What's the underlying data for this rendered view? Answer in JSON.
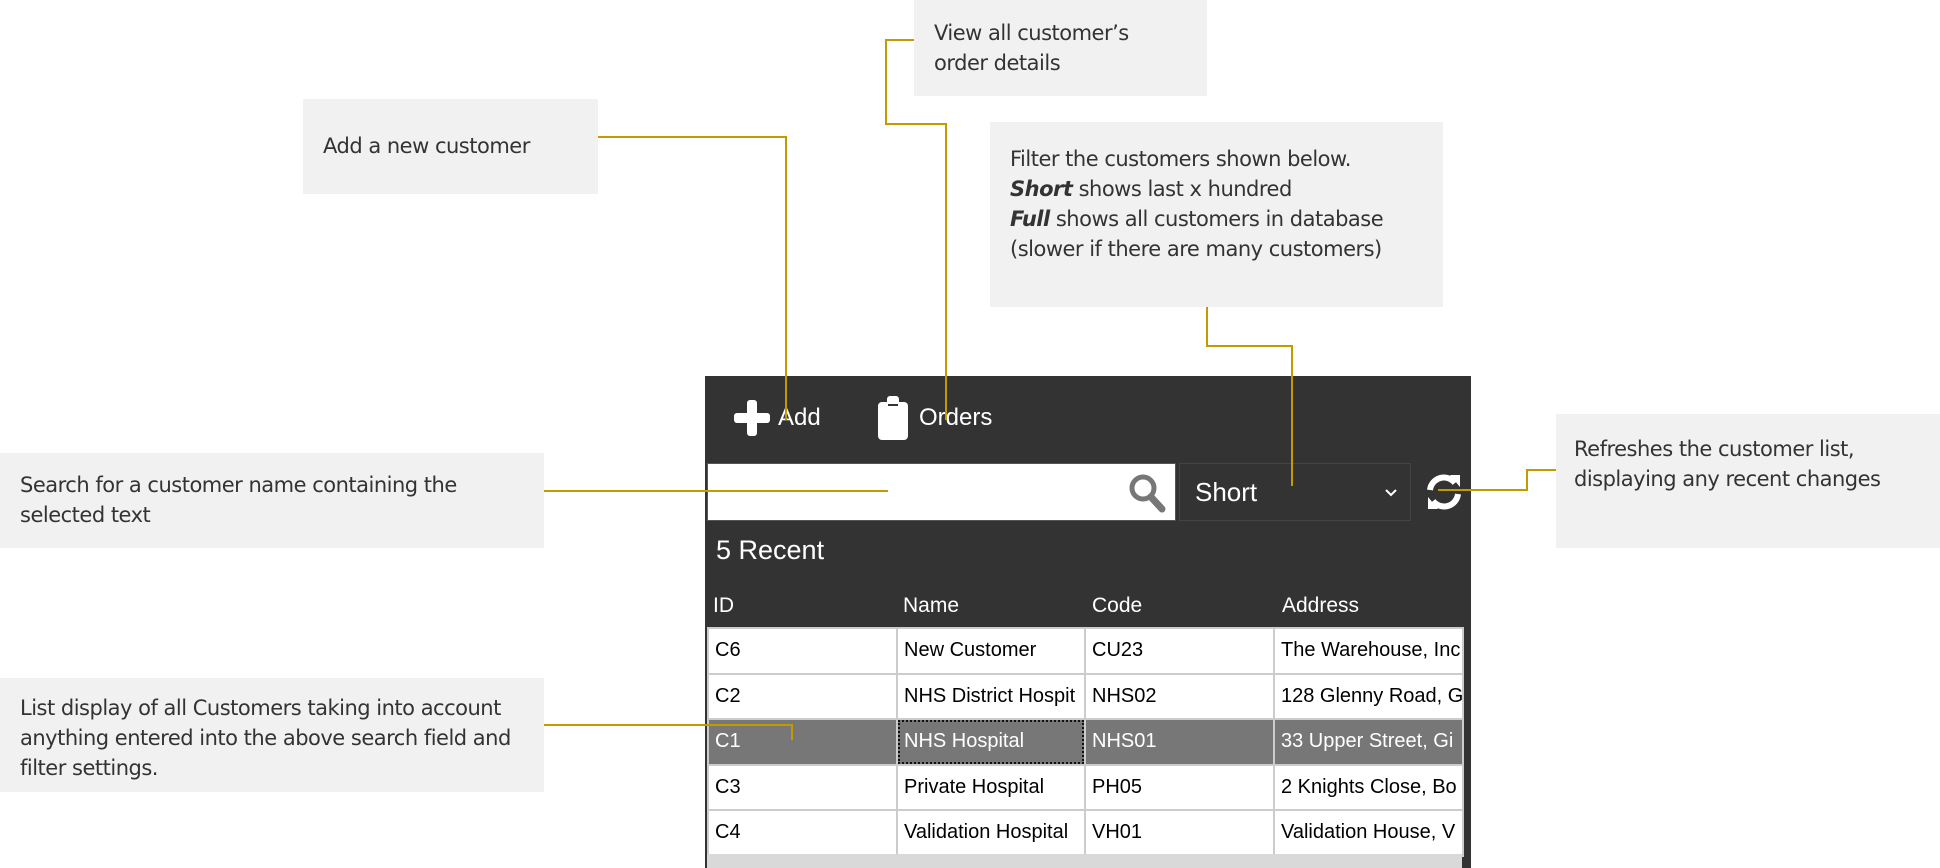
{
  "callouts": {
    "add": "Add a new customer",
    "orders": "View all customer’s order details",
    "filter_line1": "Filter the customers shown below.",
    "filter_short_label": "Short",
    "filter_short_text": " shows last x hundred",
    "filter_full_label": "Full",
    "filter_full_text": " shows all customers in database (slower if there are many customers)",
    "refresh": "Refreshes the customer list, displaying any recent changes",
    "search": "Search for a customer name containing the selected text",
    "list": "List display of all Customers taking into account anything entered into the above search field and filter settings."
  },
  "toolbar": {
    "add_label": "Add",
    "orders_label": "Orders"
  },
  "search": {
    "value": "",
    "placeholder": ""
  },
  "filter": {
    "selected": "Short"
  },
  "list_title": "5 Recent",
  "table": {
    "columns": [
      "ID",
      "Name",
      "Code",
      "Address"
    ],
    "rows": [
      [
        "C6",
        "New Customer",
        "CU23",
        "The Warehouse, Inc"
      ],
      [
        "C2",
        "NHS District Hospit",
        "NHS02",
        "128 Glenny Road, G"
      ],
      [
        "C1",
        "NHS Hospital",
        "NHS01",
        "33 Upper Street, Gi"
      ],
      [
        "C3",
        "Private Hospital",
        "PH05",
        "2 Knights Close, Bo"
      ],
      [
        "C4",
        "Validation Hospital",
        "VH01",
        "Validation House, V"
      ]
    ],
    "selected_row": 2
  },
  "colors": {
    "panel": "#333333",
    "connector": "#c49a00",
    "selected_row": "#777777",
    "callout_bg": "#f1f1f1"
  }
}
